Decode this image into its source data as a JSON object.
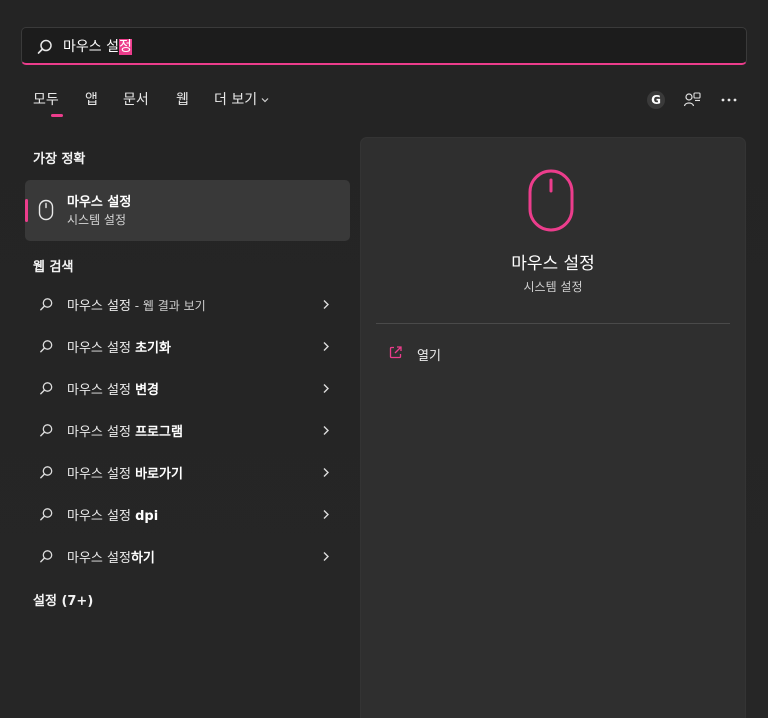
{
  "search": {
    "query_plain": "마우스 설",
    "query_highlight": "정"
  },
  "tabs": [
    {
      "label": "모두",
      "active": true
    },
    {
      "label": "앱"
    },
    {
      "label": "문서"
    },
    {
      "label": "웹"
    },
    {
      "label": "더 보기"
    }
  ],
  "toolbar": {
    "account_initial": "G",
    "icons": [
      "account-icon",
      "switch-account-icon",
      "more-icon"
    ]
  },
  "best_match": {
    "section_title": "가장 정확",
    "name": "마우스 설정",
    "sub": "시스템 설정",
    "icon": "mouse-icon"
  },
  "web_search": {
    "section_title": "웹 검색",
    "items": [
      {
        "prefix": "마우스 설정",
        "suffix": " - 웹 결과 보기",
        "bold": ""
      },
      {
        "prefix": "마우스 설정 ",
        "bold": "초기화",
        "suffix": ""
      },
      {
        "prefix": "마우스 설정 ",
        "bold": "변경",
        "suffix": ""
      },
      {
        "prefix": "마우스 설정 ",
        "bold": "프로그램",
        "suffix": ""
      },
      {
        "prefix": "마우스 설정 ",
        "bold": "바로가기",
        "suffix": ""
      },
      {
        "prefix": "마우스 설정 ",
        "bold": "dpi",
        "suffix": ""
      },
      {
        "prefix": "마우스 설정",
        "bold": "하기",
        "suffix": ""
      }
    ]
  },
  "settings_section": {
    "title": "설정 (7+)"
  },
  "preview": {
    "title": "마우스 설정",
    "sub": "시스템 설정",
    "action_label": "열기",
    "icon": "mouse-icon"
  },
  "colors": {
    "accent": "#ec3d8c"
  }
}
